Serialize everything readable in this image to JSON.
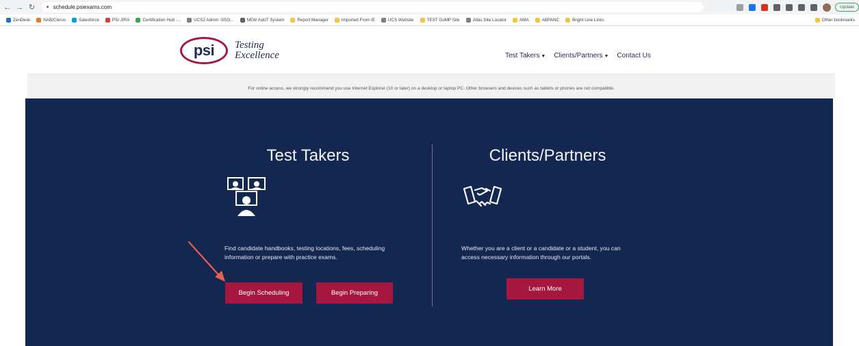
{
  "browser": {
    "url": "schedule.psiexams.com",
    "update_label": "Update",
    "bookmarks": [
      {
        "label": "ZenDesk",
        "color": "#1f73b7"
      },
      {
        "label": "NAB/Clerus",
        "color": "#e07a2e"
      },
      {
        "label": "Salesforce",
        "color": "#00a1e0"
      },
      {
        "label": "PSI JIRA",
        "color": "#d04437"
      },
      {
        "label": "Certification Hub -...",
        "color": "#34a853"
      },
      {
        "label": "UCS2 Admin -SSO...",
        "color": "#7b7f86"
      },
      {
        "label": "NEW AskIT System",
        "color": "#5f6368"
      },
      {
        "label": "Report Manager",
        "color": "#f4c542"
      },
      {
        "label": "Imported From IE",
        "color": "#f4c542"
      },
      {
        "label": "UCS Website",
        "color": "#7b7f86"
      },
      {
        "label": "TEST GoMP Site",
        "color": "#f4c542"
      },
      {
        "label": "Atlas Site Locator",
        "color": "#7b7f86"
      },
      {
        "label": "AMA",
        "color": "#f4c542"
      },
      {
        "label": "ABPANC",
        "color": "#f4c542"
      },
      {
        "label": "Bright Line Links",
        "color": "#f4c542"
      }
    ],
    "other_bookmarks": "Other bookmarks"
  },
  "site": {
    "logo_text": "psi",
    "tagline_line1": "Testing",
    "tagline_line2": "Excellence",
    "nav": {
      "test_takers": "Test Takers",
      "clients_partners": "Clients/Partners",
      "contact_us": "Contact Us"
    },
    "notice": "For online access, we strongly recommend you use Internet Explorer (10 or later) on a desktop or laptop PC. Other browsers and devices such as tablets or phones are not compatible."
  },
  "hero": {
    "test_takers": {
      "title": "Test Takers",
      "icon": "test-takers-icon",
      "description": "Find candidate handbooks, testing locations, fees, scheduling information or prepare with practice exams.",
      "begin_scheduling": "Begin Scheduling",
      "begin_preparing": "Begin Preparing"
    },
    "clients_partners": {
      "title": "Clients/Partners",
      "icon": "handshake-icon",
      "description": "Whether you are a client or a candidate or a student, you can access necessary information through our portals.",
      "learn_more": "Learn More"
    }
  },
  "colors": {
    "brand_red": "#a6173f",
    "hero_navy": "#142750",
    "annotation_arrow": "#e8604c"
  }
}
